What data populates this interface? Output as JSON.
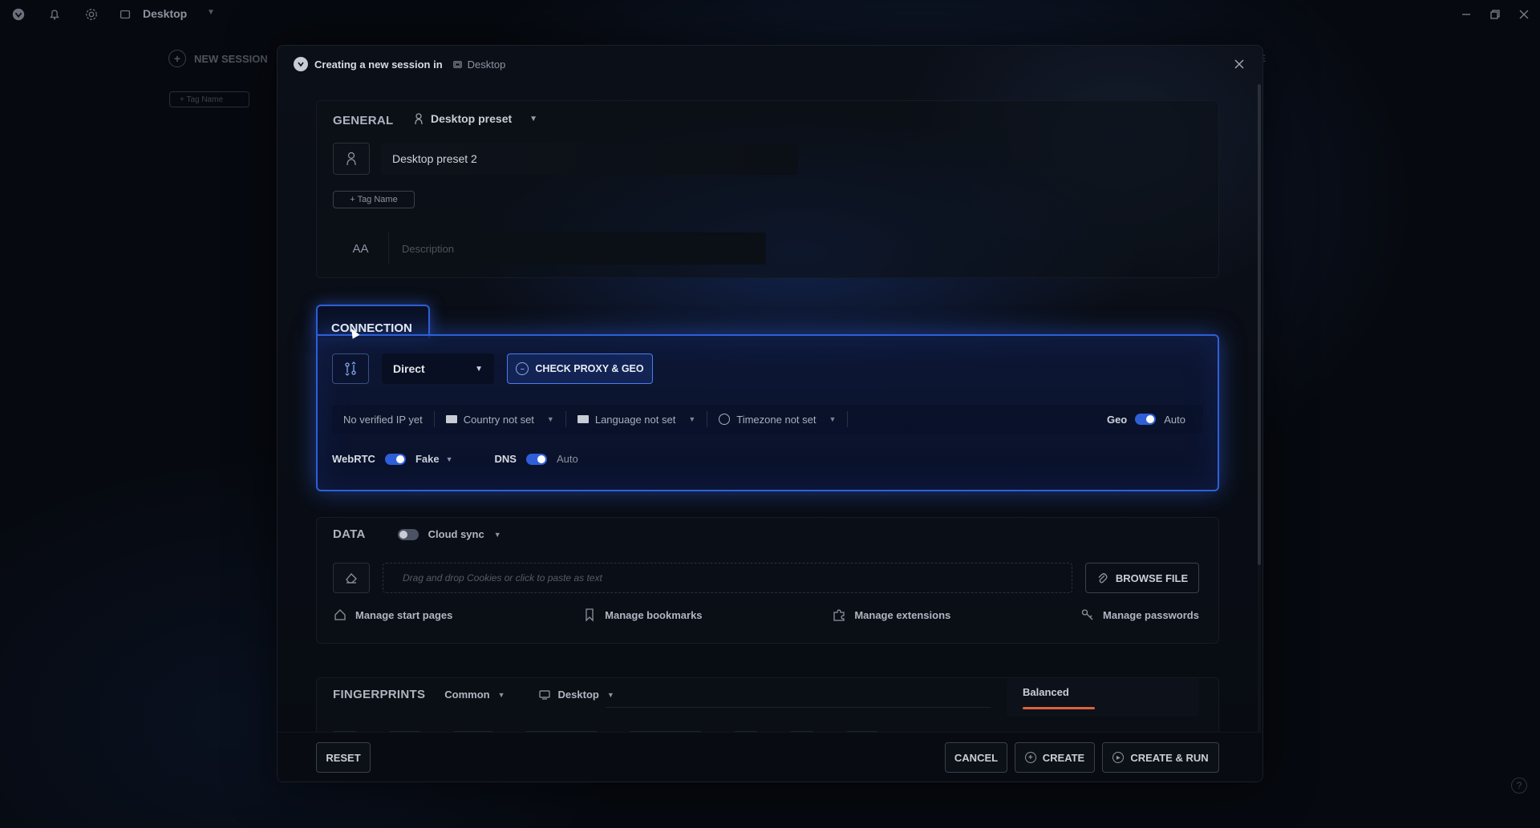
{
  "topbar": {
    "workspace_title": "Desktop",
    "icons": [
      "logo-icon",
      "bell-icon",
      "gear-icon",
      "workspace-icon",
      "chevron-down-icon"
    ],
    "window_controls": [
      "minimize-icon",
      "restore-icon",
      "close-icon"
    ]
  },
  "background": {
    "new_session_label": "NEW SESSION",
    "tag_placeholder": "+ Tag Name",
    "right_text": "E"
  },
  "dialog": {
    "header_text": "Creating a new session in",
    "header_location": "Desktop",
    "general": {
      "title": "GENERAL",
      "preset_label": "Desktop preset",
      "session_name": "Desktop preset 2",
      "tag_button": "+ Tag Name",
      "description_icon": "AΑ",
      "description_placeholder": "Description"
    },
    "connection": {
      "title": "CONNECTION",
      "proxy_type": "Direct",
      "check_button": "CHECK PROXY & GEO",
      "ip_status": "No verified IP yet",
      "country": "Country not set",
      "language": "Language not set",
      "timezone": "Timezone not set",
      "geo_label": "Geo",
      "geo_value": "Auto",
      "webrtc_label": "WebRTC",
      "webrtc_value": "Fake",
      "dns_label": "DNS",
      "dns_value": "Auto"
    },
    "data": {
      "title": "DATA",
      "cloud_sync_label": "Cloud sync",
      "drop_placeholder": "Drag and drop Cookies or click to paste as text",
      "browse_button": "BROWSE FILE",
      "manage_start_pages": "Manage start pages",
      "manage_bookmarks": "Manage bookmarks",
      "manage_extensions": "Manage extensions",
      "manage_passwords": "Manage passwords"
    },
    "fingerprints": {
      "title": "FINGERPRINTS",
      "mode": "Common",
      "platform": "Desktop",
      "profile": "Balanced"
    },
    "footer": {
      "reset": "RESET",
      "cancel": "CANCEL",
      "create": "CREATE",
      "create_run": "CREATE & RUN"
    }
  },
  "colors": {
    "accent": "#2f5fd8",
    "balanced_bar": "#d9633b",
    "background": "#06090f"
  }
}
